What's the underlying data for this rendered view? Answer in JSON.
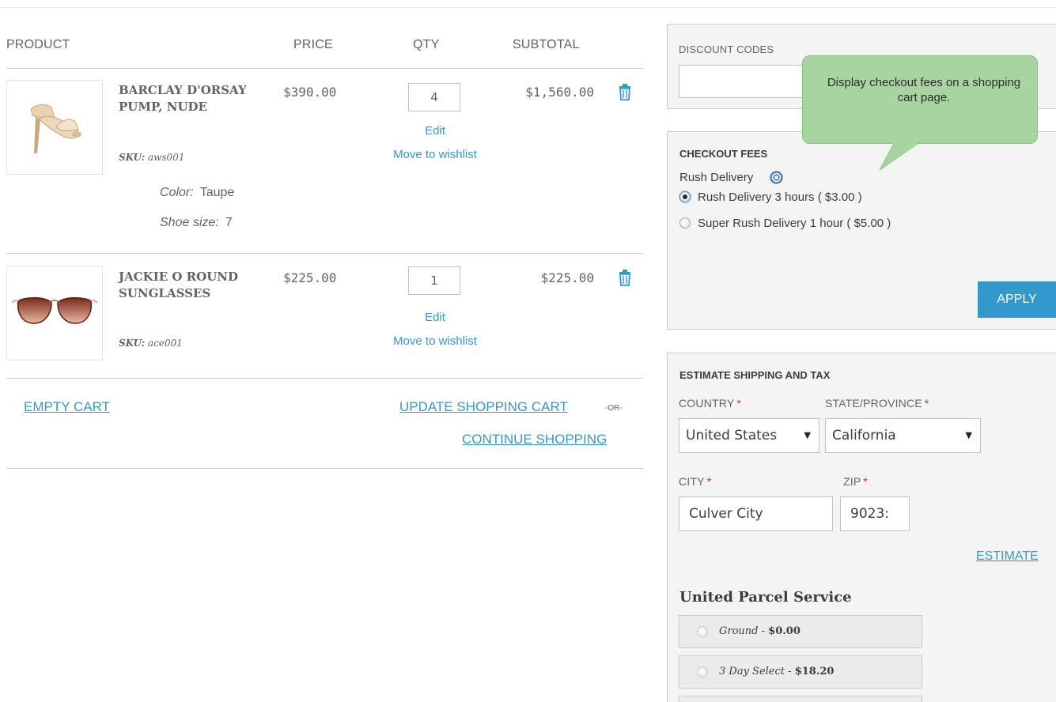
{
  "cart": {
    "headers": {
      "product": "PRODUCT",
      "price": "PRICE",
      "qty": "QTY",
      "subtotal": "SUBTOTAL"
    },
    "items": [
      {
        "name": "BARCLAY D'ORSAY PUMP, NUDE",
        "sku_label": "SKU:",
        "sku": "aws001",
        "options": [
          {
            "label": "Color:",
            "value": "Taupe"
          },
          {
            "label": "Shoe size:",
            "value": "7"
          }
        ],
        "price": "$390.00",
        "qty": "4",
        "subtotal": "$1,560.00",
        "edit": "Edit",
        "wishlist": "Move to wishlist",
        "image": "nude-pump-image"
      },
      {
        "name": "JACKIE O ROUND SUNGLASSES",
        "sku_label": "SKU:",
        "sku": "ace001",
        "options": [],
        "price": "$225.00",
        "qty": "1",
        "subtotal": "$225.00",
        "edit": "Edit",
        "wishlist": "Move to wishlist",
        "image": "sunglasses-image"
      }
    ],
    "actions": {
      "empty": "EMPTY CART",
      "update": "UPDATE SHOPPING CART",
      "or": "-OR-",
      "continue": "CONTINUE SHOPPING"
    }
  },
  "discount": {
    "title": "DISCOUNT CODES",
    "value": ""
  },
  "tooltip": {
    "text": "Display checkout fees on a shopping cart page."
  },
  "checkout_fees": {
    "title": "CHECKOUT FEES",
    "group": "Rush Delivery",
    "options": [
      {
        "label": "Rush Delivery 3 hours ( $3.00 )",
        "checked": true
      },
      {
        "label": "Super Rush Delivery 1 hour ( $5.00 )",
        "checked": false
      }
    ],
    "apply": "APPLY"
  },
  "shipping": {
    "title": "ESTIMATE SHIPPING AND TAX",
    "country_label": "COUNTRY",
    "country": "United States",
    "state_label": "STATE/PROVINCE",
    "state": "California",
    "city_label": "CITY",
    "city": "Culver City",
    "zip_label": "ZIP",
    "zip": "9023:",
    "required": "*",
    "estimate": "ESTIMATE",
    "carrier": "United Parcel Service",
    "methods": [
      {
        "name": "Ground",
        "sep": " - ",
        "price": "$0.00"
      },
      {
        "name": "3 Day Select",
        "sep": " - ",
        "price": "$18.20"
      }
    ]
  },
  "colors": {
    "accent": "#3399cc",
    "required": "#df280a",
    "tooltip": "#a8d4a2",
    "panel_bg": "#f4f4f4"
  }
}
